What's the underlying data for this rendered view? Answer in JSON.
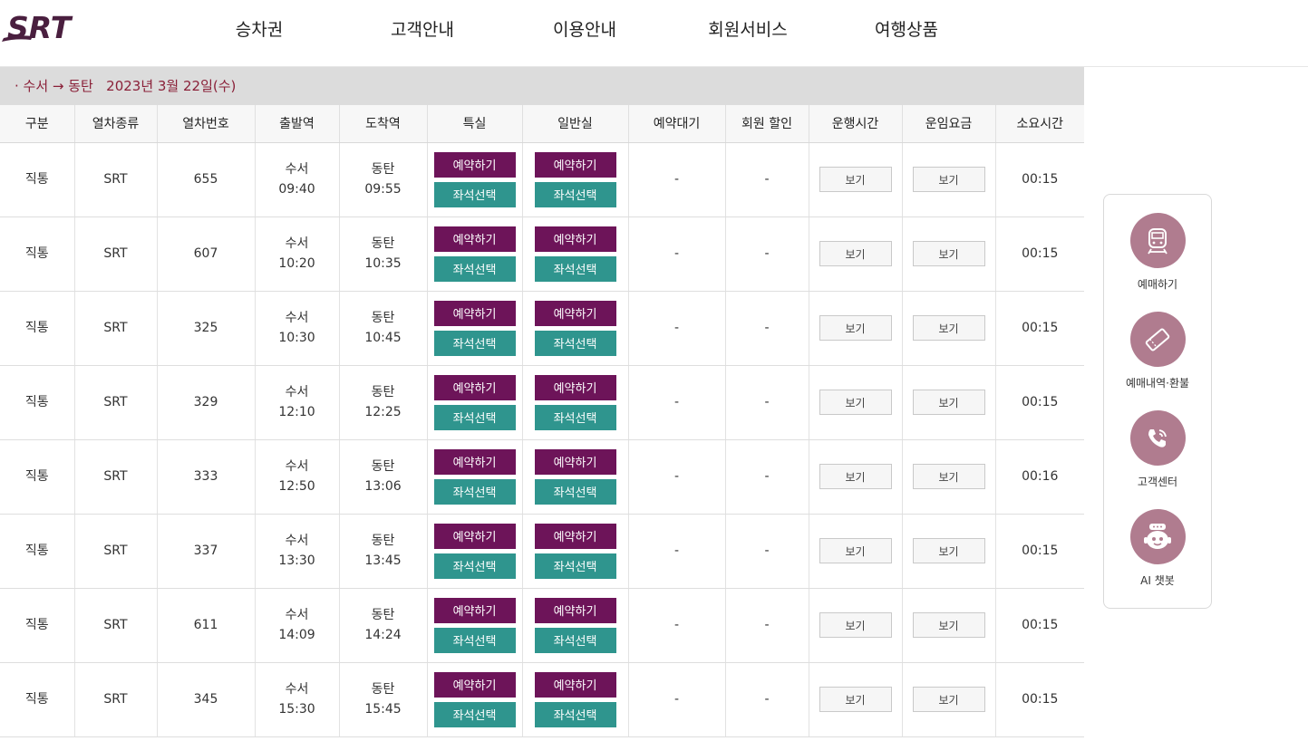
{
  "brand": {
    "logo_text": "SRT",
    "logo_color": "#4a1f3f"
  },
  "nav": [
    "승차권",
    "고객안내",
    "이용안내",
    "회원서비스",
    "여행상품"
  ],
  "route": {
    "text": "· 수서 → 동탄   2023년 3월 22일(수)"
  },
  "table": {
    "headers": [
      "구분",
      "열차종류",
      "열차번호",
      "출발역",
      "도착역",
      "특실",
      "일반실",
      "예약대기",
      "회원 할인",
      "운행시간",
      "운임요금",
      "소요시간"
    ],
    "reserve_label": "예약하기",
    "seat_label": "좌석선택",
    "view_label": "보기",
    "rows": [
      {
        "type": "직통",
        "kind": "SRT",
        "number": "655",
        "dep_station": "수서",
        "dep_time": "09:40",
        "arr_station": "동탄",
        "arr_time": "09:55",
        "waitlist": "-",
        "discount": "-",
        "duration": "00:15"
      },
      {
        "type": "직통",
        "kind": "SRT",
        "number": "607",
        "dep_station": "수서",
        "dep_time": "10:20",
        "arr_station": "동탄",
        "arr_time": "10:35",
        "waitlist": "-",
        "discount": "-",
        "duration": "00:15"
      },
      {
        "type": "직통",
        "kind": "SRT",
        "number": "325",
        "dep_station": "수서",
        "dep_time": "10:30",
        "arr_station": "동탄",
        "arr_time": "10:45",
        "waitlist": "-",
        "discount": "-",
        "duration": "00:15"
      },
      {
        "type": "직통",
        "kind": "SRT",
        "number": "329",
        "dep_station": "수서",
        "dep_time": "12:10",
        "arr_station": "동탄",
        "arr_time": "12:25",
        "waitlist": "-",
        "discount": "-",
        "duration": "00:15"
      },
      {
        "type": "직통",
        "kind": "SRT",
        "number": "333",
        "dep_station": "수서",
        "dep_time": "12:50",
        "arr_station": "동탄",
        "arr_time": "13:06",
        "waitlist": "-",
        "discount": "-",
        "duration": "00:16"
      },
      {
        "type": "직통",
        "kind": "SRT",
        "number": "337",
        "dep_station": "수서",
        "dep_time": "13:30",
        "arr_station": "동탄",
        "arr_time": "13:45",
        "waitlist": "-",
        "discount": "-",
        "duration": "00:15"
      },
      {
        "type": "직통",
        "kind": "SRT",
        "number": "611",
        "dep_station": "수서",
        "dep_time": "14:09",
        "arr_station": "동탄",
        "arr_time": "14:24",
        "waitlist": "-",
        "discount": "-",
        "duration": "00:15"
      },
      {
        "type": "직통",
        "kind": "SRT",
        "number": "345",
        "dep_station": "수서",
        "dep_time": "15:30",
        "arr_station": "동탄",
        "arr_time": "15:45",
        "waitlist": "-",
        "discount": "-",
        "duration": "00:15"
      }
    ]
  },
  "quick_menu": [
    {
      "label": "예매하기",
      "icon": "train-icon"
    },
    {
      "label": "예매내역·환불",
      "icon": "ticket-icon"
    },
    {
      "label": "고객센터",
      "icon": "phone-icon"
    },
    {
      "label": "AI 챗봇",
      "icon": "chatbot-icon"
    }
  ],
  "colors": {
    "reserve": "#6d1459",
    "seat": "#2f958e",
    "route_text": "#8a2038",
    "quick_circle": "#b07c8f"
  }
}
